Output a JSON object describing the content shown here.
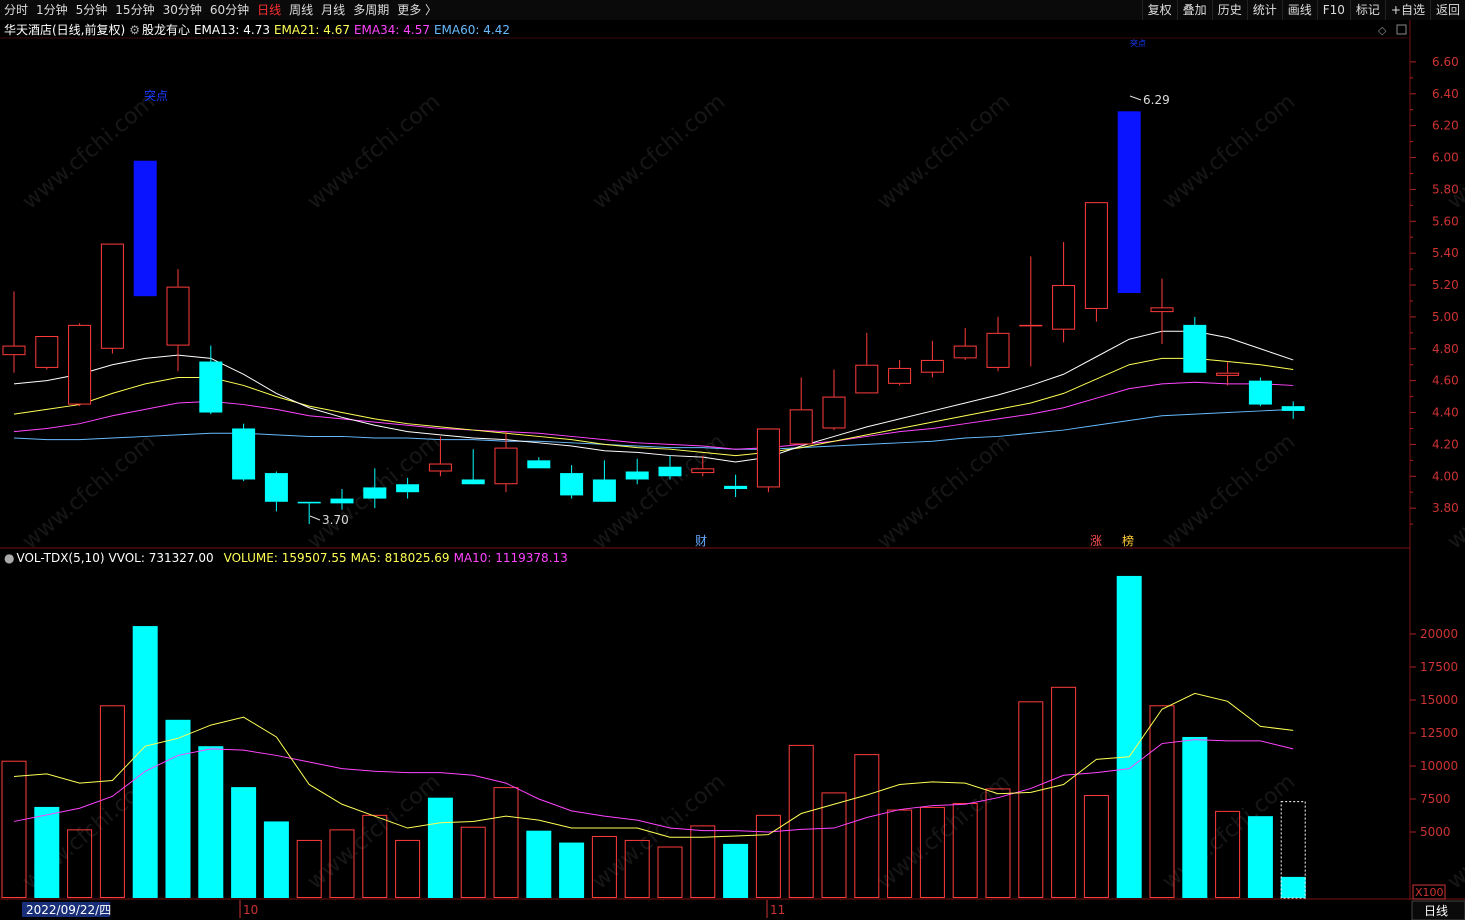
{
  "toolbar": {
    "left": [
      "分时",
      "1分钟",
      "5分钟",
      "15分钟",
      "30分钟",
      "60分钟",
      "日线",
      "周线",
      "月线",
      "多周期",
      "更多 〉"
    ],
    "active": "日线",
    "right": [
      "复权",
      "叠加",
      "历史",
      "统计",
      "画线",
      "F10",
      "标记",
      "+自选",
      "返回"
    ]
  },
  "price_panel": {
    "title": "华天酒店(日线,前复权)",
    "indicator": "股龙有心",
    "ema": [
      {
        "label": "EMA13: 4.73",
        "color": "#ffffff"
      },
      {
        "label": "EMA21: 4.67",
        "color": "#ffff55"
      },
      {
        "label": "EMA34: 4.57",
        "color": "#ff44ff"
      },
      {
        "label": "EMA60: 4.42",
        "color": "#66bbff"
      }
    ],
    "marker_top_left": "突点",
    "marker_top_right": "突点",
    "high_label": "6.29",
    "low_label": "3.70",
    "event_cai": "财",
    "event_zhang": "涨",
    "event_bang": "榜",
    "price_ticks": [
      "6.60",
      "6.40",
      "6.20",
      "6.00",
      "5.80",
      "5.60",
      "5.40",
      "5.20",
      "5.00",
      "4.80",
      "4.60",
      "4.40",
      "4.20",
      "4.00",
      "3.80"
    ]
  },
  "vol_panel": {
    "title": "VOL-TDX(5,10)",
    "vvol": "VVOL: 731327.00",
    "volume": "VOLUME: 159507.55",
    "ma5": "MA5: 818025.69",
    "ma10": "MA10: 1119378.13",
    "vol_ticks": [
      "20000",
      "17500",
      "15000",
      "12500",
      "10000",
      "7500",
      "5000"
    ],
    "unit": "X100"
  },
  "x_axis": {
    "date": "2022/09/22/四",
    "month_oct": "10",
    "month_nov": "11",
    "period": "日线"
  },
  "colors": {
    "up": "#ff3c3c",
    "down": "#00ffff",
    "special": "#0a14ff",
    "ema13": "#ffffff",
    "ema21": "#ffff55",
    "ema34": "#ff44ff",
    "ema60": "#66bbff"
  },
  "chart_data": {
    "type": "candlestick",
    "candles": [
      {
        "o": 4.76,
        "h": 5.16,
        "l": 4.65,
        "c": 4.82
      },
      {
        "o": 4.68,
        "h": 4.8,
        "l": 4.67,
        "c": 4.88
      },
      {
        "o": 4.45,
        "h": 4.96,
        "l": 4.44,
        "c": 4.95
      },
      {
        "o": 4.8,
        "h": 5.46,
        "l": 4.77,
        "c": 5.46
      },
      {
        "o": 5.98,
        "h": 5.98,
        "l": 5.13,
        "c": 5.13
      },
      {
        "o": 4.82,
        "h": 5.3,
        "l": 4.66,
        "c": 5.19
      },
      {
        "o": 4.72,
        "h": 4.82,
        "l": 4.39,
        "c": 4.4
      },
      {
        "o": 4.3,
        "h": 4.33,
        "l": 3.97,
        "c": 3.98
      },
      {
        "o": 4.02,
        "h": 4.03,
        "l": 3.78,
        "c": 3.84
      },
      {
        "o": 3.84,
        "h": 3.84,
        "l": 3.7,
        "c": 3.83
      },
      {
        "o": 3.86,
        "h": 3.92,
        "l": 3.79,
        "c": 3.83
      },
      {
        "o": 3.93,
        "h": 4.05,
        "l": 3.8,
        "c": 3.86
      },
      {
        "o": 3.95,
        "h": 3.99,
        "l": 3.86,
        "c": 3.9
      },
      {
        "o": 4.03,
        "h": 4.25,
        "l": 4.0,
        "c": 4.08
      },
      {
        "o": 3.98,
        "h": 4.17,
        "l": 3.98,
        "c": 3.95
      },
      {
        "o": 3.95,
        "h": 4.28,
        "l": 3.9,
        "c": 4.18
      },
      {
        "o": 4.1,
        "h": 4.12,
        "l": 4.05,
        "c": 4.05
      },
      {
        "o": 4.02,
        "h": 4.07,
        "l": 3.86,
        "c": 3.88
      },
      {
        "o": 3.98,
        "h": 4.1,
        "l": 3.85,
        "c": 3.84
      },
      {
        "o": 4.03,
        "h": 4.11,
        "l": 3.95,
        "c": 3.98
      },
      {
        "o": 4.06,
        "h": 4.13,
        "l": 3.98,
        "c": 4.0
      },
      {
        "o": 4.02,
        "h": 4.13,
        "l": 4.0,
        "c": 4.05
      },
      {
        "o": 3.94,
        "h": 4.01,
        "l": 3.87,
        "c": 3.92
      },
      {
        "o": 3.93,
        "h": 4.3,
        "l": 3.9,
        "c": 4.3
      },
      {
        "o": 4.2,
        "h": 4.62,
        "l": 4.2,
        "c": 4.42
      },
      {
        "o": 4.3,
        "h": 4.67,
        "l": 4.29,
        "c": 4.5
      },
      {
        "o": 4.52,
        "h": 4.9,
        "l": 4.52,
        "c": 4.7
      },
      {
        "o": 4.58,
        "h": 4.73,
        "l": 4.57,
        "c": 4.68
      },
      {
        "o": 4.65,
        "h": 4.85,
        "l": 4.62,
        "c": 4.73
      },
      {
        "o": 4.74,
        "h": 4.93,
        "l": 4.73,
        "c": 4.82
      },
      {
        "o": 4.68,
        "h": 5.0,
        "l": 4.66,
        "c": 4.9
      },
      {
        "o": 4.95,
        "h": 5.38,
        "l": 4.69,
        "c": 4.95
      },
      {
        "o": 4.92,
        "h": 5.47,
        "l": 4.84,
        "c": 5.2
      },
      {
        "o": 5.05,
        "h": 5.72,
        "l": 4.97,
        "c": 5.72
      },
      {
        "o": 6.29,
        "h": 6.29,
        "l": 5.15,
        "c": 5.15
      },
      {
        "o": 5.03,
        "h": 5.24,
        "l": 4.83,
        "c": 5.06
      },
      {
        "o": 4.95,
        "h": 5.0,
        "l": 4.65,
        "c": 4.65
      },
      {
        "o": 4.63,
        "h": 4.72,
        "l": 4.57,
        "c": 4.65
      },
      {
        "o": 4.6,
        "h": 4.62,
        "l": 4.44,
        "c": 4.45
      },
      {
        "o": 4.44,
        "h": 4.47,
        "l": 4.36,
        "c": 4.41
      }
    ],
    "ema13": [
      4.58,
      4.6,
      4.64,
      4.7,
      4.74,
      4.76,
      4.74,
      4.64,
      4.52,
      4.43,
      4.37,
      4.32,
      4.28,
      4.26,
      4.24,
      4.23,
      4.21,
      4.19,
      4.16,
      4.15,
      4.13,
      4.12,
      4.09,
      4.12,
      4.19,
      4.25,
      4.31,
      4.36,
      4.41,
      4.46,
      4.51,
      4.57,
      4.64,
      4.75,
      4.86,
      4.91,
      4.91,
      4.87,
      4.8,
      4.73
    ],
    "ema21": [
      4.39,
      4.42,
      4.45,
      4.52,
      4.58,
      4.62,
      4.62,
      4.57,
      4.5,
      4.44,
      4.4,
      4.36,
      4.33,
      4.31,
      4.29,
      4.27,
      4.25,
      4.23,
      4.2,
      4.18,
      4.17,
      4.15,
      4.13,
      4.15,
      4.18,
      4.22,
      4.26,
      4.3,
      4.34,
      4.38,
      4.42,
      4.46,
      4.52,
      4.61,
      4.7,
      4.74,
      4.74,
      4.72,
      4.7,
      4.67
    ],
    "ema34": [
      4.28,
      4.3,
      4.33,
      4.38,
      4.42,
      4.46,
      4.47,
      4.45,
      4.42,
      4.38,
      4.36,
      4.34,
      4.32,
      4.3,
      4.29,
      4.28,
      4.27,
      4.25,
      4.23,
      4.21,
      4.2,
      4.19,
      4.17,
      4.18,
      4.2,
      4.22,
      4.25,
      4.28,
      4.3,
      4.33,
      4.36,
      4.39,
      4.43,
      4.49,
      4.55,
      4.58,
      4.59,
      4.58,
      4.58,
      4.57
    ],
    "ema60": [
      4.24,
      4.23,
      4.23,
      4.24,
      4.25,
      4.26,
      4.27,
      4.27,
      4.26,
      4.25,
      4.25,
      4.24,
      4.24,
      4.23,
      4.23,
      4.22,
      4.22,
      4.21,
      4.2,
      4.19,
      4.18,
      4.18,
      4.17,
      4.17,
      4.18,
      4.19,
      4.2,
      4.21,
      4.22,
      4.24,
      4.25,
      4.27,
      4.29,
      4.32,
      4.35,
      4.38,
      4.39,
      4.4,
      4.41,
      4.42
    ],
    "volume": [
      10400,
      6900,
      5200,
      14600,
      20600,
      13500,
      11500,
      8400,
      5800,
      4400,
      5200,
      6300,
      4400,
      7600,
      5400,
      8400,
      5100,
      4200,
      4700,
      4400,
      3900,
      5500,
      4100,
      6300,
      11600,
      8000,
      10900,
      6700,
      6900,
      7200,
      8300,
      14900,
      16000,
      7800,
      24400,
      14600,
      12200,
      6600,
      6200,
      1600
    ],
    "vol_up_or_down": [
      "up",
      "down",
      "up",
      "up",
      "down",
      "down",
      "down",
      "down",
      "down",
      "up",
      "up",
      "up",
      "up",
      "down",
      "up",
      "up",
      "down",
      "down",
      "up",
      "up",
      "up",
      "up",
      "down",
      "up",
      "up",
      "up",
      "up",
      "up",
      "up",
      "up",
      "up",
      "up",
      "up",
      "up",
      "down",
      "up",
      "down",
      "up",
      "down",
      "down"
    ],
    "ma5": [
      9200,
      9400,
      8700,
      8900,
      11500,
      12100,
      13100,
      13700,
      12200,
      8600,
      7100,
      6200,
      5300,
      5700,
      5800,
      6200,
      5900,
      5300,
      5300,
      5300,
      4600,
      4600,
      4700,
      4800,
      6400,
      7100,
      7800,
      8600,
      8800,
      8700,
      7900,
      8000,
      8600,
      10500,
      10700,
      14300,
      15500,
      14900,
      13000,
      12700
    ],
    "ma10": [
      5800,
      6300,
      6800,
      7700,
      9600,
      10800,
      11300,
      11200,
      10800,
      10300,
      9800,
      9600,
      9500,
      9500,
      9300,
      8700,
      7500,
      6600,
      6200,
      5900,
      5300,
      5100,
      5100,
      5000,
      5200,
      5300,
      6100,
      6700,
      7000,
      7100,
      7600,
      8300,
      9300,
      9500,
      9800,
      11700,
      12000,
      11900,
      11900,
      11300
    ],
    "price_range": [
      3.55,
      6.75
    ],
    "volume_range": [
      0,
      25000
    ],
    "last_volume_dotted": 7300
  }
}
